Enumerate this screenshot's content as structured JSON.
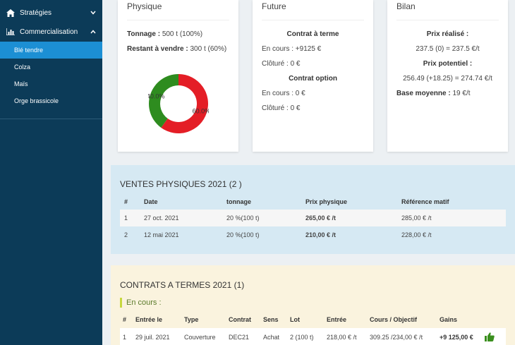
{
  "sidebar": {
    "groups": [
      {
        "label": "Stratégies",
        "icon": "home-icon",
        "chevron": "down"
      },
      {
        "label": "Commercialisation",
        "icon": "bar-chart-icon",
        "chevron": "up"
      }
    ],
    "items": [
      {
        "label": "Blé tendre",
        "active": true
      },
      {
        "label": "Colza",
        "active": false
      },
      {
        "label": "Maïs",
        "active": false
      },
      {
        "label": "Orge brassicole",
        "active": false
      }
    ]
  },
  "physique": {
    "title": "Physique",
    "tonnage_label": "Tonnage :",
    "tonnage_value": "500 t (100%)",
    "restant_label": "Restant à vendre :",
    "restant_value": "300 t (60%)",
    "donut": {
      "slices": [
        {
          "label": "60.0%",
          "value": 60,
          "color": "#e41e26"
        },
        {
          "label": "40.0%",
          "value": 40,
          "color": "#2e8c1f"
        }
      ]
    }
  },
  "future": {
    "title": "Future",
    "terme_heading": "Contrat à terme",
    "terme_encours": "En cours : +9125 €",
    "terme_cloture": "Clôturé : 0 €",
    "option_heading": "Contrat option",
    "option_encours": "En cours : 0 €",
    "option_cloture": "Clôturé : 0 €"
  },
  "bilan": {
    "title": "Bilan",
    "prix_realise_heading": "Prix réalisé :",
    "prix_realise_value": "237.5 (0) = 237.5 €/t",
    "prix_potentiel_heading": "Prix potentiel :",
    "prix_potentiel_value": "256.49 (+18.25) = 274.74 €/t",
    "base_label": "Base moyenne :",
    "base_value": "19 €/t"
  },
  "ventes": {
    "title": "VENTES PHYSIQUES 2021 (2 )",
    "columns": [
      "#",
      "Date",
      "tonnage",
      "Prix physique",
      "Référence matif"
    ],
    "rows": [
      [
        "1",
        "27 oct. 2021",
        "20 %(100 t)",
        "265,00 € /t",
        "285,00 € /t"
      ],
      [
        "2",
        "12 mai 2021",
        "20 %(100 t)",
        "210,00 € /t",
        "228,00 € /t"
      ]
    ]
  },
  "contrats": {
    "title": "CONTRATS A TERMES 2021 (1)",
    "subtitle": "En cours :",
    "columns": [
      "#",
      "Entrée le",
      "Type",
      "Contrat",
      "Sens",
      "Lot",
      "Entrée",
      "Cours / Objectif",
      "Gains"
    ],
    "rows": [
      [
        "1",
        "29 juil. 2021",
        "Couverture",
        "DEC21",
        "Achat",
        "2 (100 t)",
        "218,00 € /t",
        "309.25 /234,00 € /t",
        "+9 125,00 €"
      ]
    ],
    "gain_icon": "thumbs-up-icon",
    "gain_color": "#3a8f1e"
  }
}
